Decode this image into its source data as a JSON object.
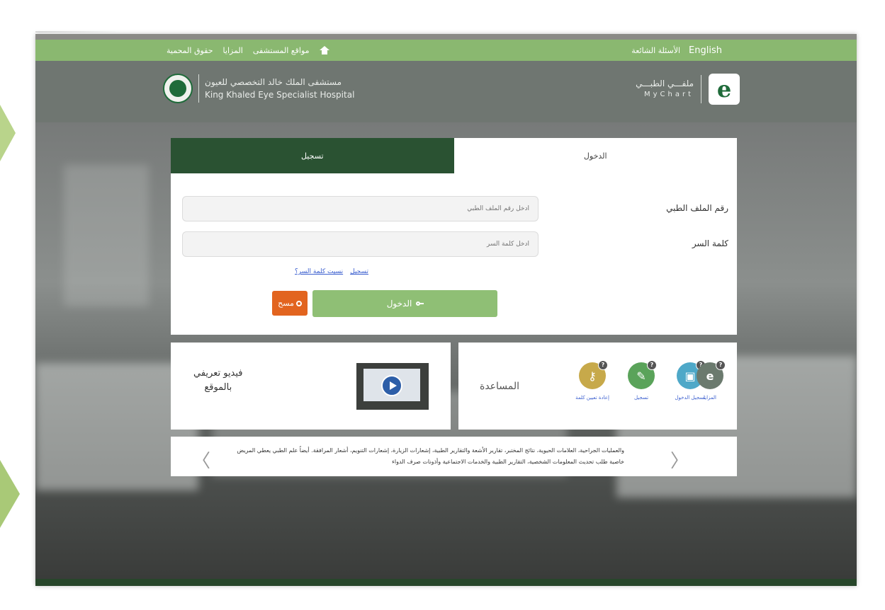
{
  "topbar": {
    "home_icon": "home-icon",
    "links": [
      "مواقع المستشفى",
      "المزايا",
      "حقوق المحمية"
    ],
    "faq": "الأسئلة الشائعة",
    "language": "English"
  },
  "header": {
    "hospital_name_ar": "مستشفى الملك خالد التخصصي للعيون",
    "hospital_name_en": "King Khaled Eye Specialist Hospital",
    "mychart_ar": "ملفـــي الطبـــي",
    "mychart_en": "MyChart",
    "logo_letter": "e"
  },
  "login": {
    "tab_register": "تسجيل",
    "tab_login": "الدخول",
    "mrn_label": "رقم الملف الطبي",
    "mrn_placeholder": "أدخل رقم الملف الطبي",
    "password_label": "كلمة السر",
    "password_placeholder": "أدخل كلمة السر",
    "link_register": "تسجيل",
    "link_forgot": "نسيت كلمة السر؟",
    "login_button": "الدخول",
    "clear_button": "مسح"
  },
  "video": {
    "title_line1": "فيديو تعريفي",
    "title_line2": "بالموقع"
  },
  "help": {
    "title": "المساعدة",
    "items": [
      {
        "label": "المزايا",
        "icon": "e-icon",
        "color": "#6b7a6e"
      },
      {
        "label": "تسجيل الدخول",
        "icon": "lock-icon",
        "color": "#4ea8c8"
      },
      {
        "label": "تسجيل",
        "icon": "edit-icon",
        "color": "#5aa35a"
      },
      {
        "label": "إعادة تعيين كلمة",
        "icon": "key-icon",
        "color": "#c7a94a"
      }
    ]
  },
  "ticker": {
    "text": "والعمليات الجراحية، العلامات الحيوية، نتائج المختبر، تقارير الأشعة والتقارير الطبية، إشعارات الزيارة، إشعارات التنويم، أشعار المرافقة. أيضاً علم الطبي يعطي المريض خاصية طلب تحديث المعلومات الشخصية، التقارير الطبية والخدمات الاجتماعية وأذونات صرف الدواء"
  }
}
